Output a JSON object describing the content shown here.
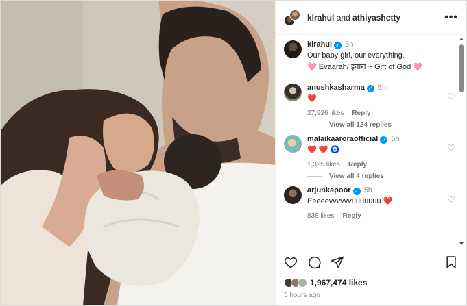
{
  "header": {
    "user1": "klrahul",
    "joiner": "and",
    "user2": "athiyashetty",
    "more_icon": "more-horizontal-icon"
  },
  "caption": {
    "username": "klrahul",
    "time": "5h",
    "line1": "Our baby girl, our everything.",
    "line2": "🩷 Evaarah/ इवारा ~ Gift of God 🩷"
  },
  "comments": [
    {
      "username": "anushkasharma",
      "time": "5h",
      "text": "❤️",
      "likes": "27,926 likes",
      "reply_label": "Reply",
      "view_replies": "View all 124 replies"
    },
    {
      "username": "malaikaaroraofficial",
      "time": "5h",
      "text": "❤️ ❤️ 🧿",
      "likes": "1,325 likes",
      "reply_label": "Reply",
      "view_replies": "View all 4 replies"
    },
    {
      "username": "arjunkapoor",
      "time": "5h",
      "text": "Eeeeevvvvvvuuuuuuu ❤️",
      "likes": "838 likes",
      "reply_label": "Reply"
    }
  ],
  "actions": {
    "like_icon": "heart-outline-icon",
    "comment_icon": "comment-icon",
    "share_icon": "share-icon",
    "save_icon": "bookmark-icon"
  },
  "likes_summary": "1,967,474 likes",
  "posted_ago": "5 hours ago"
}
